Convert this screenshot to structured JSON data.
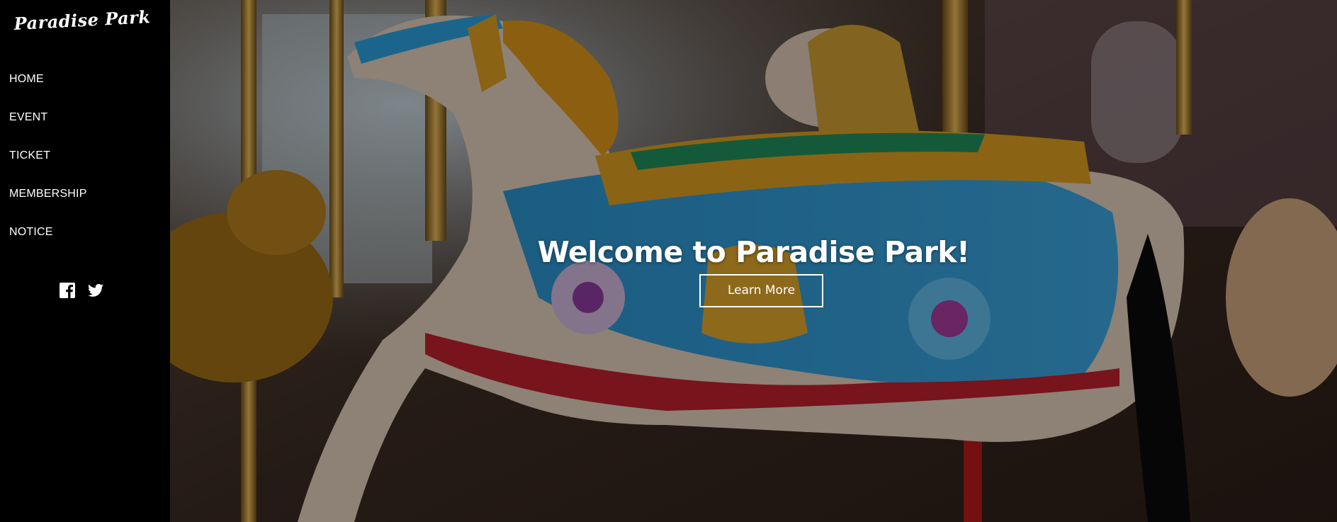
{
  "brand": {
    "logo_text": "Paradise Park"
  },
  "nav": {
    "items": [
      {
        "label": "HOME"
      },
      {
        "label": "EVENT"
      },
      {
        "label": "TICKET"
      },
      {
        "label": "MEMBERSHIP"
      },
      {
        "label": "NOTICE"
      }
    ]
  },
  "social": {
    "icons": [
      "facebook-icon",
      "twitter-icon"
    ]
  },
  "hero": {
    "title": "Welcome to Paradise Park!",
    "button_label": "Learn More",
    "background": "carousel-horses-photo"
  },
  "colors": {
    "sidebar_bg": "#000000",
    "text": "#ffffff"
  }
}
